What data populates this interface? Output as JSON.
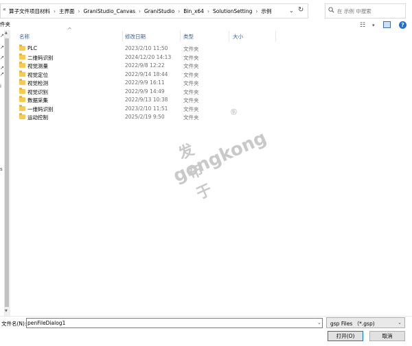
{
  "address_bar": {
    "overflow_glyph": "«",
    "crumbs": [
      "算子文件项目材料",
      "主界面",
      "GraniStudio_Canvas",
      "GraniStudio",
      "Bin_x64",
      "SolutionSetting",
      "示例"
    ],
    "separator": "›",
    "dropdown_glyph": "⌄",
    "refresh_glyph": "↻"
  },
  "search": {
    "placeholder": "在 示例 中搜索"
  },
  "toolbar": {
    "partial_label": "件夹",
    "view_icon": "☷",
    "view_dd": "▾",
    "help": "?"
  },
  "nav": {
    "glyphs": [
      "↗",
      "↗",
      "↗",
      "↗",
      "↗",
      "↗"
    ],
    "partial_1": "i",
    "partial_2": "s"
  },
  "columns": {
    "name": "名称",
    "date": "修改日期",
    "type": "类型",
    "size": "大小",
    "sort_glyph": "^"
  },
  "files": [
    {
      "name": "PLC",
      "date": "2023/2/10 11:50",
      "type": "文件夹"
    },
    {
      "name": "二维码识别",
      "date": "2024/12/20 14:13",
      "type": "文件夹"
    },
    {
      "name": "视觉测量",
      "date": "2022/9/8 12:22",
      "type": "文件夹"
    },
    {
      "name": "视觉定位",
      "date": "2022/9/14 18:44",
      "type": "文件夹"
    },
    {
      "name": "视觉检测",
      "date": "2022/9/9 16:11",
      "type": "文件夹"
    },
    {
      "name": "视觉识别",
      "date": "2022/9/9 14:49",
      "type": "文件夹"
    },
    {
      "name": "数据采集",
      "date": "2022/9/13 10:38",
      "type": "文件夹"
    },
    {
      "name": "一维码识别",
      "date": "2023/2/10 11:51",
      "type": "文件夹"
    },
    {
      "name": "运动控制",
      "date": "2025/2/19 9:50",
      "type": "文件夹"
    }
  ],
  "watermark": {
    "cn": "发布于",
    "en": "gongkong",
    "reg": "®"
  },
  "bottom": {
    "filename_label": "文件名(N):",
    "filename_value": "penFileDialog1",
    "filetype_value": "gsp Files （*.gsp)",
    "open_label": "打开(O)",
    "cancel_label": "取消"
  }
}
